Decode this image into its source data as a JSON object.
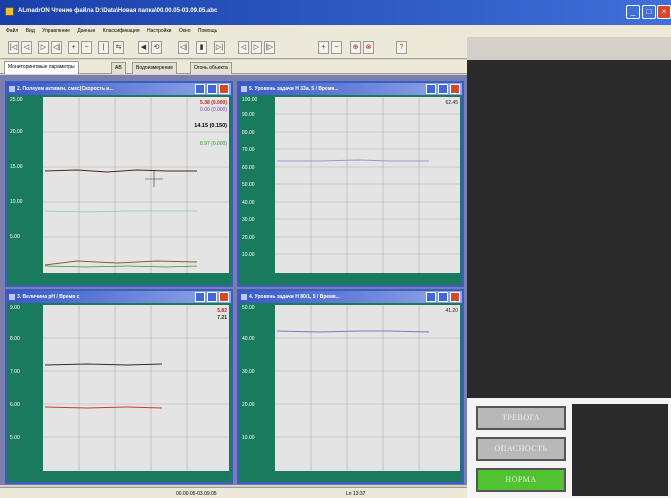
{
  "window": {
    "title": "ALmadrON Чтение файла D:\\Data\\Новая папка\\00.00.05-03.09.05.abc",
    "min": "_",
    "max": "□",
    "close": "×"
  },
  "menu": [
    "Файл",
    "Вид",
    "Управление",
    "Данные",
    "Классификация",
    "Настройки",
    "Окно",
    "Помощь"
  ],
  "toolbar_icons": [
    "|◁",
    "◁",
    "▷",
    "◁|",
    "+",
    "−",
    "|",
    "⇆",
    "◀",
    "⟲",
    "◁|",
    "▮",
    "▷|",
    "◁",
    "▷",
    "|▷",
    "+",
    "−",
    "⊕",
    "⊗",
    "?"
  ],
  "tabs": [
    "Мониторинговые параметры",
    "АВ",
    "Водоизмерение",
    "Огонь объекта"
  ],
  "panes": [
    {
      "title": "2. Полеуем активен, смес[Скорость и...",
      "y_ticks": [
        "25.00",
        "20.00",
        "15.00",
        "10.00",
        "5.00"
      ],
      "readouts": [
        {
          "text": "5.38 (0.000)",
          "color": "#d02020"
        },
        {
          "text": "0.00 (0.000)",
          "color": "#8040a0"
        },
        {
          "text": "14.15 (0.150)",
          "color": "#000000"
        },
        {
          "text": "8.97 (0.000)",
          "color": "#2a9a2a"
        }
      ]
    },
    {
      "title": "5. Уровень задачи Н 33а, 5 / Время...",
      "y_ticks": [
        "100.00",
        "90.00",
        "80.00",
        "70.00",
        "60.00",
        "50.00",
        "40.00",
        "30.00",
        "20.00",
        "10.00"
      ],
      "readouts": [
        {
          "text": "62.45",
          "color": "#202020"
        }
      ]
    },
    {
      "title": "3. Величина pH / Время с",
      "y_ticks": [
        "9.00",
        "8.00",
        "7.00",
        "6.00",
        "5.00"
      ],
      "readouts": [
        {
          "text": "5.82",
          "color": "#d02020"
        },
        {
          "text": "7.21",
          "color": "#202020"
        }
      ]
    },
    {
      "title": "4. Уровень задачи Н 80/1, 5 / Время...",
      "y_ticks": [
        "50.00",
        "40.00",
        "30.00",
        "20.00",
        "10.00"
      ],
      "readouts": [
        {
          "text": "41.20",
          "color": "#202020"
        }
      ]
    }
  ],
  "status": {
    "left": "00.00.05-03.09.05",
    "right": "Ln 13:37"
  },
  "alarms": {
    "alarm": "ТРЕВОГА",
    "danger": "ОПАСНОСТЬ",
    "normal": "НОРМА"
  },
  "colors": {
    "plot_bg": "#e4e4e4",
    "axis_bg": "#1a7a5e",
    "alarm_green": "#52c232",
    "mdi_bg": "#7a7fb0"
  }
}
